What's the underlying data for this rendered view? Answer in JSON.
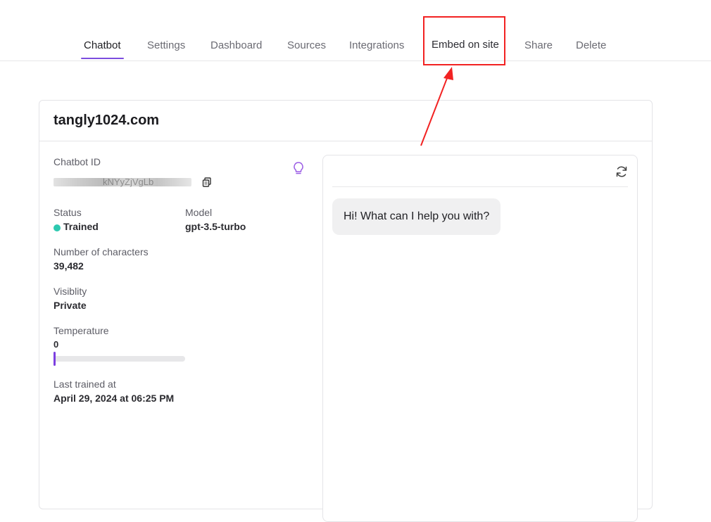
{
  "tabs": [
    {
      "label": "Chatbot",
      "active": true
    },
    {
      "label": "Settings"
    },
    {
      "label": "Dashboard"
    },
    {
      "label": "Sources"
    },
    {
      "label": "Integrations"
    },
    {
      "label": "Embed on site"
    },
    {
      "label": "Share"
    },
    {
      "label": "Delete"
    }
  ],
  "chatbot": {
    "title": "tangly1024.com",
    "id_label": "Chatbot ID",
    "id_visible_fragment": "kNYyZjVgLb",
    "status_label": "Status",
    "status_value": "Trained",
    "model_label": "Model",
    "model_value": "gpt-3.5-turbo",
    "chars_label": "Number of characters",
    "chars_value": "39,482",
    "visibility_label": "Visiblity",
    "visibility_value": "Private",
    "temperature_label": "Temperature",
    "temperature_value": "0",
    "last_trained_label": "Last trained at",
    "last_trained_value": "April 29, 2024 at 06:25 PM"
  },
  "chat": {
    "greeting": "Hi! What can I help you with?"
  },
  "icons": {
    "copy": "copy-icon",
    "hint": "lightbulb-icon",
    "refresh": "refresh-icon"
  },
  "colors": {
    "accent": "#7c4ddf",
    "status_ok": "#2dc9b0",
    "annotation": "#f22222"
  }
}
